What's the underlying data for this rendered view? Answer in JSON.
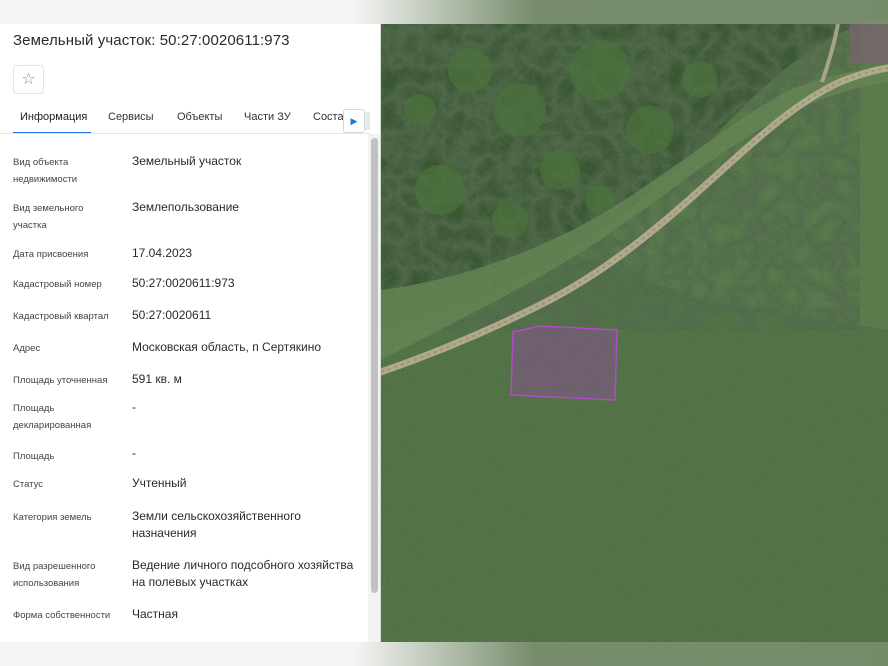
{
  "panel": {
    "title": "Земельный участок: 50:27:0020611:973",
    "tabs": [
      "Информация",
      "Сервисы",
      "Объекты",
      "Части ЗУ",
      "Соста"
    ],
    "rows": [
      {
        "label": "Вид объекта недвижимости",
        "value": "Земельный участок"
      },
      {
        "label": "Вид земельного участка",
        "value": "Землепользование"
      },
      {
        "label": "Дата присвоения",
        "value": "17.04.2023"
      },
      {
        "label": "Кадастровый номер",
        "value": "50:27:0020611:973"
      },
      {
        "label": "Кадастровый квартал",
        "value": "50:27:0020611"
      },
      {
        "label": "Адрес",
        "value": "Московская область, п Сертякино"
      },
      {
        "label": "Площадь уточненная",
        "value": "591 кв. м"
      },
      {
        "label": "Площадь декларированная",
        "value": "-"
      },
      {
        "label": "Площадь",
        "value": "-"
      },
      {
        "label": "Статус",
        "value": "Учтенный"
      },
      {
        "label": "Категория земель",
        "value": "Земли сельскохозяйственного назначения"
      },
      {
        "label": "Вид разрешенного использования",
        "value": "Ведение личного подсобного хозяйства на полевых участках"
      },
      {
        "label": "Форма собственности",
        "value": "Частная"
      }
    ]
  },
  "colors": {
    "accent": "#1a73e8",
    "parcel": "#a23fb4",
    "forest": "#2b4a22",
    "field": "#466a39",
    "road": "#b9ae8e"
  },
  "icons": {
    "favorite": "star-icon",
    "tab_scroll": "chevron-right-icon"
  }
}
